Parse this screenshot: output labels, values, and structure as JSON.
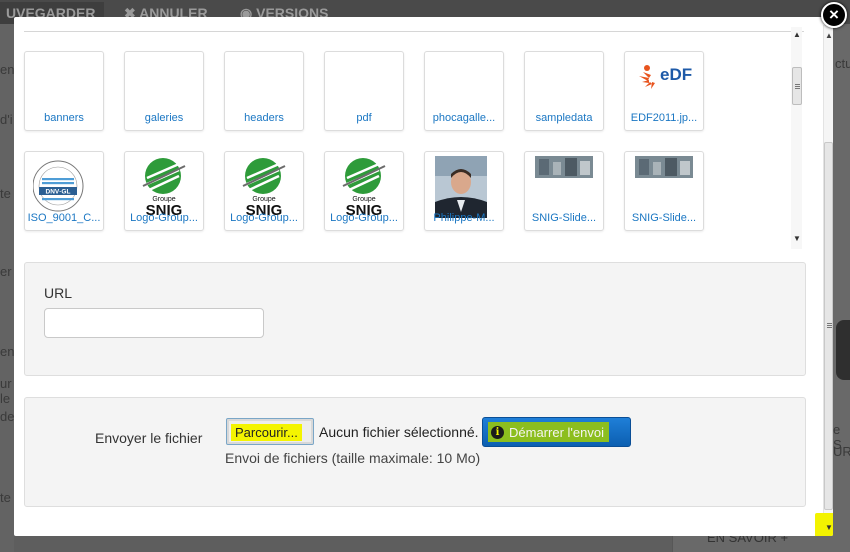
{
  "background": {
    "tabs": [
      "UVEGARDER",
      "ANNULER",
      "VERSIONS"
    ],
    "right_snippets": [
      "ctu",
      "e S",
      "UR",
      "EN SAVOIR +"
    ],
    "left_snippets": [
      "en",
      "d'i",
      "te",
      "er",
      "en",
      "ur le",
      "de",
      "te"
    ]
  },
  "modal": {
    "close_symbol": "×"
  },
  "media": {
    "items": [
      {
        "label": "banners",
        "kind": "folder"
      },
      {
        "label": "galeries",
        "kind": "folder"
      },
      {
        "label": "headers",
        "kind": "folder"
      },
      {
        "label": "pdf",
        "kind": "folder"
      },
      {
        "label": "phocagalle...",
        "kind": "folder"
      },
      {
        "label": "sampledata",
        "kind": "folder"
      },
      {
        "label": "EDF2011.jp...",
        "kind": "image",
        "icon": "edf-logo",
        "logo_text": "eDF"
      },
      {
        "label": "ISO_9001_C...",
        "kind": "image",
        "icon": "dnv-gl-cert",
        "logo_text": "DNV·GL"
      },
      {
        "label": "Logo-Group...",
        "kind": "image",
        "icon": "snig-logo",
        "logo_text_top": "Groupe",
        "logo_text": "SNIG"
      },
      {
        "label": "Logo-Group...",
        "kind": "image",
        "icon": "snig-logo",
        "logo_text_top": "Groupe",
        "logo_text": "SNIG"
      },
      {
        "label": "Logo-Group...",
        "kind": "image",
        "icon": "snig-logo",
        "logo_text_top": "Groupe",
        "logo_text": "SNIG"
      },
      {
        "label": "Philippe-M...",
        "kind": "image",
        "icon": "portrait-photo"
      },
      {
        "label": "SNIG-Slide...",
        "kind": "image",
        "icon": "slide-photo"
      },
      {
        "label": "SNIG-Slide...",
        "kind": "image",
        "icon": "slide-photo"
      }
    ]
  },
  "url_panel": {
    "label": "URL",
    "value": "",
    "placeholder": ""
  },
  "upload": {
    "label": "Envoyer le fichier",
    "browse_label": "Parcourir...",
    "no_file_text": "Aucun fichier sélectionné.",
    "start_label": "Démarrer l'envoi",
    "hint": "Envoi de fichiers (taille maximale: 10 Mo)"
  },
  "colors": {
    "highlight": "#f4f400",
    "link": "#1b77c3",
    "primary_button": "#0c5fb1",
    "snig_green": "#2e9b3a",
    "edf_orange": "#e8541e",
    "edf_blue": "#1e5aa8"
  }
}
